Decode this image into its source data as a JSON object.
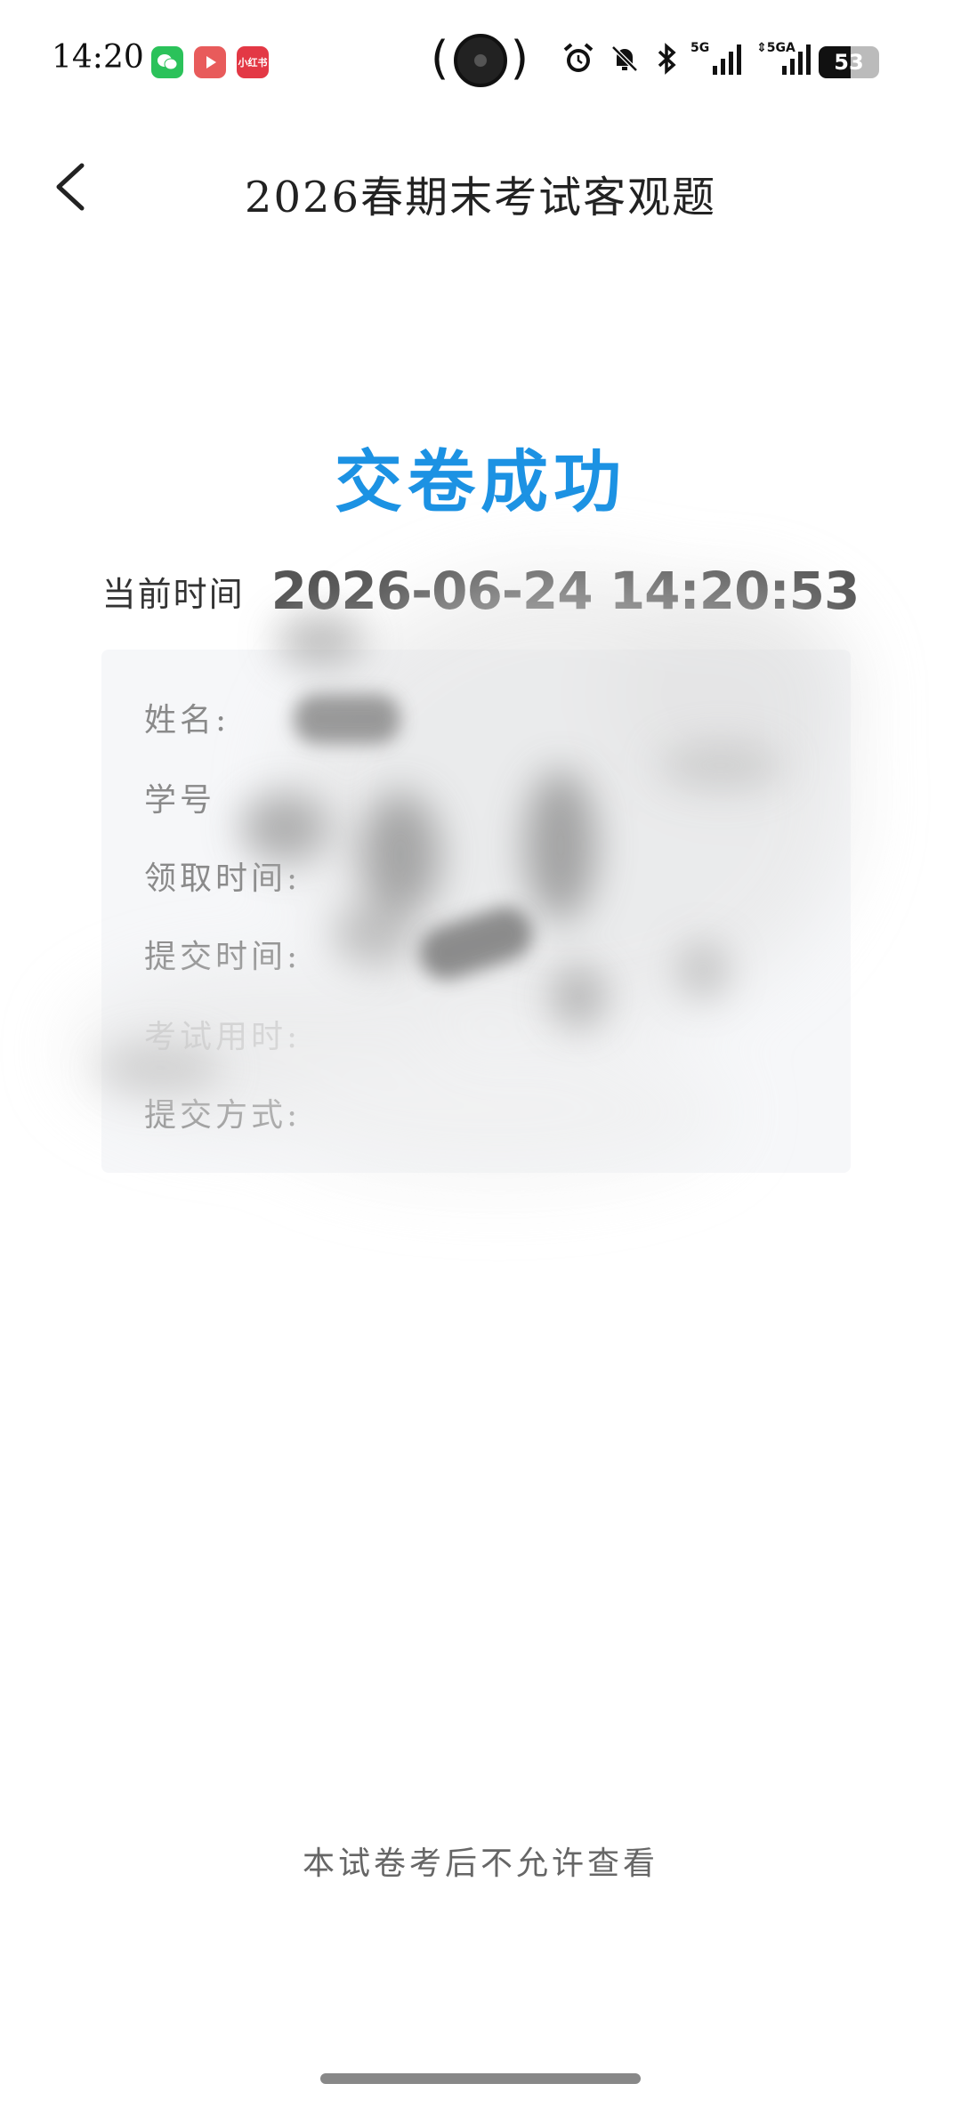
{
  "status_bar": {
    "time": "14:20",
    "apps": [
      {
        "name": "wechat-icon",
        "glyph": "✉"
      },
      {
        "name": "video-app-icon",
        "glyph": "▶"
      },
      {
        "name": "xiaohongshu-icon",
        "glyph": "小红书"
      }
    ],
    "signal1_label": "5G",
    "signal2_label": "⇕5GA",
    "battery_level": "53",
    "battery_fraction": 0.53
  },
  "nav": {
    "title": "2026春期末考试客观题"
  },
  "result": {
    "title": "交卷成功",
    "time_label": "当前时间",
    "time_value": "2026-06-24 14:20:53"
  },
  "info": {
    "name_label": "姓名:",
    "id_label": "学号",
    "receive_label": "领取时间:",
    "submit_label": "提交时间:",
    "duration_label": "考试用时:",
    "method_label": "提交方式:"
  },
  "footer": {
    "notice": "本试卷考后不允许查看"
  },
  "colors": {
    "accent": "#1c92e3"
  }
}
